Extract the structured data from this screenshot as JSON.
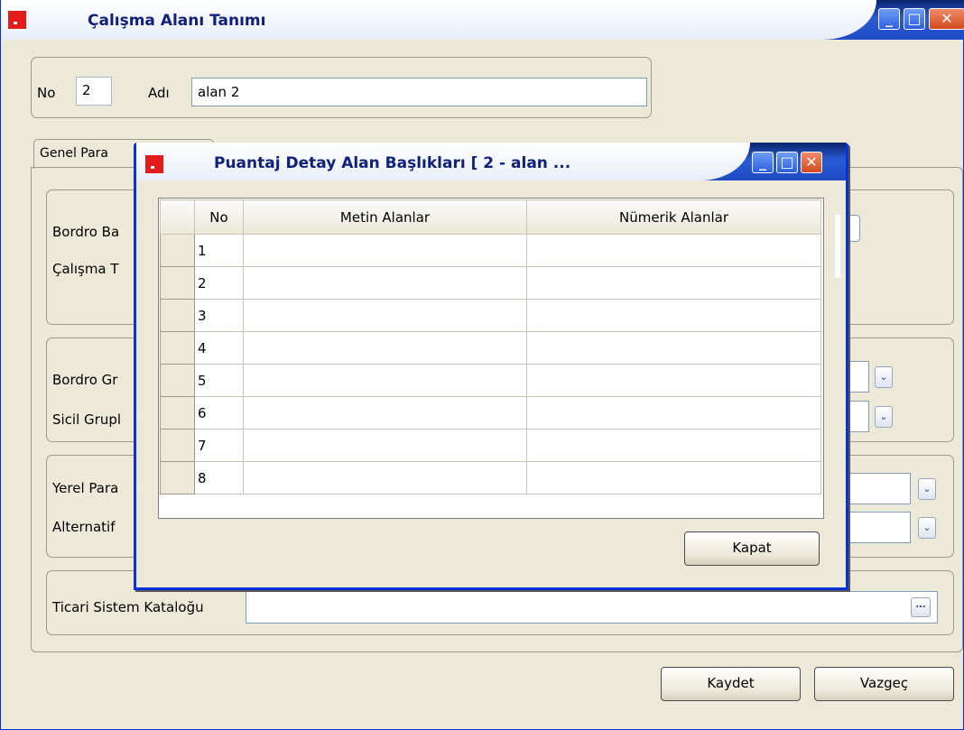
{
  "main_window": {
    "title": "Çalışma Alanı Tanımı",
    "no_label": "No",
    "no_value": "2",
    "adi_label": "Adı",
    "adi_value": "alan 2",
    "tab_label": "Genel Para",
    "labels": {
      "bordro_ba": "Bordro Ba",
      "calisma_t": "Çalışma T",
      "bordro_gr": "Bordro Gr",
      "sicil_grup": "Sicil Grupl",
      "yerel_para": "Yerel Para",
      "alternatif": "Alternatif",
      "ticari": "Ticari Sistem Kataloğu"
    },
    "buttons": {
      "save": "Kaydet",
      "cancel": "Vazgeç"
    }
  },
  "dialog": {
    "title": "Puantaj Detay Alan Başlıkları [ 2 - alan ...",
    "columns": [
      "No",
      "Metin Alanlar",
      "Nümerik Alanlar"
    ],
    "rows": [
      "1",
      "2",
      "3",
      "4",
      "5",
      "6",
      "7",
      "8"
    ],
    "close_button": "Kapat"
  },
  "icons": {
    "minimize": "minimize-icon",
    "maximize": "maximize-icon",
    "close": "close-icon",
    "dropdown": "chevron-down-icon",
    "ellipsis": "ellipsis-icon"
  },
  "colors": {
    "titlebar_blue": "#1f4bc4",
    "title_text": "#10217a",
    "window_bg": "#ece9d8",
    "close_red": "#d24a1c"
  }
}
